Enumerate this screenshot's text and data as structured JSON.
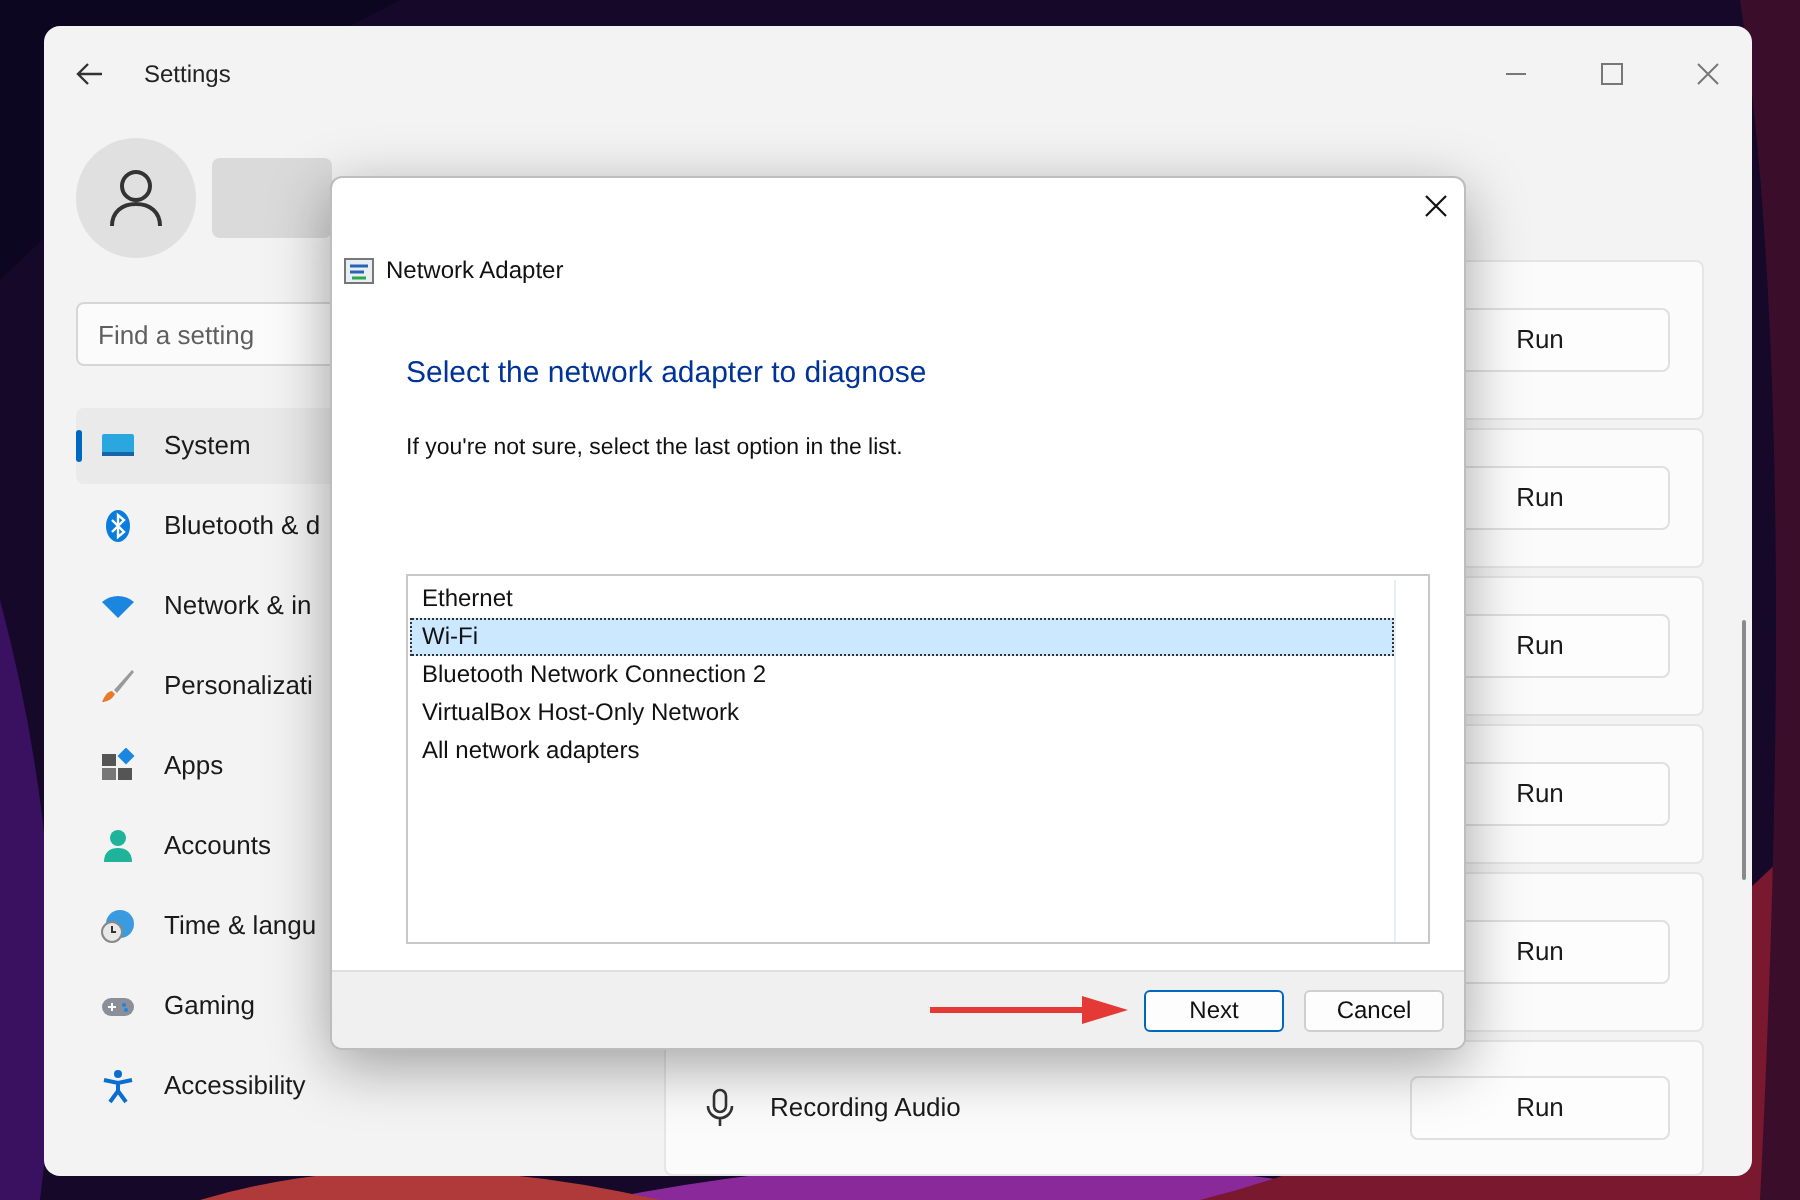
{
  "settings_window": {
    "title": "Settings",
    "search": {
      "placeholder": "Find a setting"
    },
    "nav": [
      {
        "label": "System",
        "selected": true
      },
      {
        "label": "Bluetooth & d",
        "selected": false
      },
      {
        "label": "Network & in",
        "selected": false
      },
      {
        "label": "Personalizati",
        "selected": false
      },
      {
        "label": "Apps",
        "selected": false
      },
      {
        "label": "Accounts",
        "selected": false
      },
      {
        "label": "Time & langu",
        "selected": false
      },
      {
        "label": "Gaming",
        "selected": false
      },
      {
        "label": "Accessibility",
        "selected": false
      }
    ],
    "troubleshooters": [
      {
        "action": "Run"
      },
      {
        "action": "Run"
      },
      {
        "action": "Run"
      },
      {
        "action": "Run"
      },
      {
        "action": "Run"
      },
      {
        "name": "Recording Audio",
        "action": "Run"
      }
    ]
  },
  "dialog": {
    "title": "Network Adapter",
    "heading": "Select the network adapter to diagnose",
    "instruction": "If you're not sure, select the last option in the list.",
    "adapters": [
      {
        "label": "Ethernet",
        "selected": false
      },
      {
        "label": "Wi-Fi",
        "selected": true
      },
      {
        "label": "Bluetooth Network Connection 2",
        "selected": false
      },
      {
        "label": "VirtualBox Host-Only Network",
        "selected": false
      },
      {
        "label": "All network adapters",
        "selected": false
      }
    ],
    "buttons": [
      {
        "label": "Next",
        "kind": "default"
      },
      {
        "label": "Cancel",
        "kind": "normal"
      }
    ]
  }
}
